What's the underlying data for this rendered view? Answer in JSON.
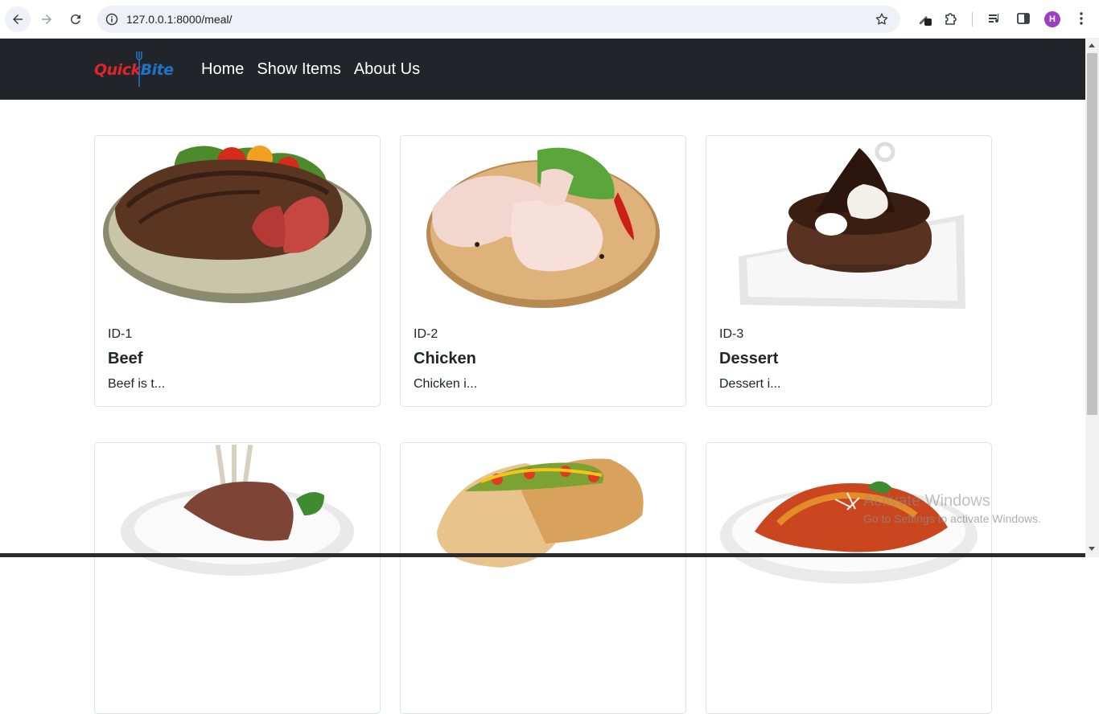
{
  "browser": {
    "url": "127.0.0.1:8000/meal/",
    "profile_initial": "H"
  },
  "site": {
    "logo": {
      "part1": "Quick",
      "part2": "Bite"
    },
    "nav": [
      "Home",
      "Show Items",
      "About Us"
    ]
  },
  "meals": [
    {
      "id": "ID-1",
      "title": "Beef",
      "desc": "Beef is t...",
      "image": "steak-plate"
    },
    {
      "id": "ID-2",
      "title": "Chicken",
      "desc": "Chicken i...",
      "image": "raw-chicken-board"
    },
    {
      "id": "ID-3",
      "title": "Dessert",
      "desc": "Dessert i...",
      "image": "chocolate-cake"
    },
    {
      "id": "",
      "title": "",
      "desc": "",
      "image": "lamb-chops"
    },
    {
      "id": "",
      "title": "",
      "desc": "",
      "image": "tacos"
    },
    {
      "id": "",
      "title": "",
      "desc": "",
      "image": "pasta"
    }
  ],
  "watermark": {
    "title": "Activate Windows",
    "subtitle": "Go to Settings to activate Windows."
  },
  "colors": {
    "navbar": "#212529",
    "logo_red": "#e0252b",
    "logo_blue": "#1e73c8",
    "avatar": "#9c3fc5"
  }
}
